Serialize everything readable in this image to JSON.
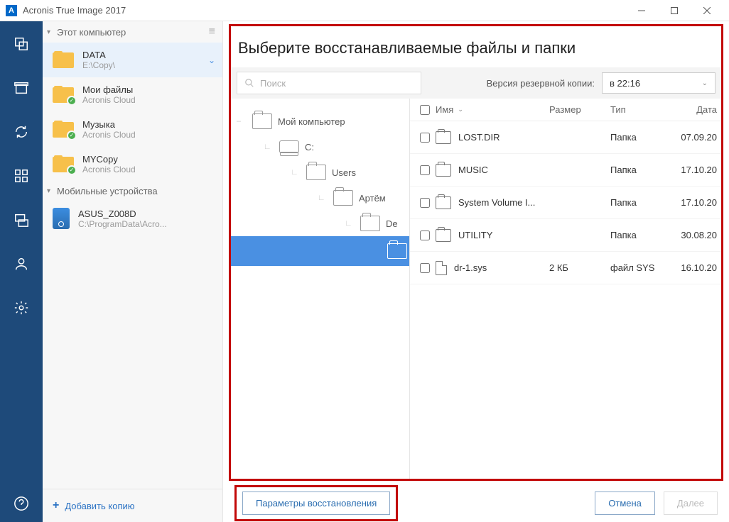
{
  "window": {
    "title": "Acronis True Image 2017"
  },
  "sidebar": {
    "section1_label": "Этот компьютер",
    "items": [
      {
        "title": "DATA",
        "sub": "E:\\Copy\\"
      },
      {
        "title": "Мои файлы",
        "sub": "Acronis Cloud"
      },
      {
        "title": "Музыка",
        "sub": "Acronis Cloud"
      },
      {
        "title": "MYCopy",
        "sub": "Acronis Cloud"
      }
    ],
    "section2_label": "Мобильные устройства",
    "device": {
      "title": "ASUS_Z008D",
      "sub": "C:\\ProgramData\\Acro..."
    },
    "add_label": "Добавить копию"
  },
  "main": {
    "title": "Выберите восстанавливаемые файлы и папки",
    "search_placeholder": "Поиск",
    "version_label": "Версия резервной копии:",
    "version_value": "в 22:16",
    "tree": [
      {
        "label": "Мой компьютер",
        "icon": "folder",
        "indent": 0
      },
      {
        "label": "C:",
        "icon": "drive",
        "indent": 1
      },
      {
        "label": "Users",
        "icon": "folder",
        "indent": 2
      },
      {
        "label": "Артём",
        "icon": "folder",
        "indent": 3
      },
      {
        "label": "De",
        "icon": "folder",
        "indent": 4
      }
    ],
    "columns": {
      "name": "Имя",
      "size": "Размер",
      "type": "Тип",
      "date": "Дата"
    },
    "rows": [
      {
        "name": "LOST.DIR",
        "size": "",
        "type": "Папка",
        "date": "07.09.20",
        "icon": "folder"
      },
      {
        "name": "MUSIC",
        "size": "",
        "type": "Папка",
        "date": "17.10.20",
        "icon": "folder"
      },
      {
        "name": "System Volume I...",
        "size": "",
        "type": "Папка",
        "date": "17.10.20",
        "icon": "folder"
      },
      {
        "name": "UTILITY",
        "size": "",
        "type": "Папка",
        "date": "30.08.20",
        "icon": "folder"
      },
      {
        "name": "dr-1.sys",
        "size": "2 КБ",
        "type": "файл SYS",
        "date": "16.10.20",
        "icon": "file"
      }
    ]
  },
  "footer": {
    "options": "Параметры восстановления",
    "cancel": "Отмена",
    "next": "Далее"
  }
}
